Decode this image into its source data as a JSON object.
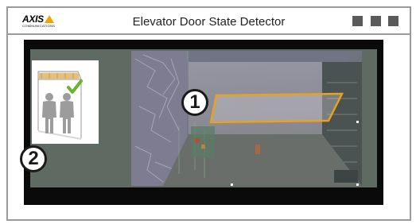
{
  "header": {
    "logo_text": "AXIS",
    "logo_subtext": "COMMUNICATIONS",
    "title": "Elevator Door State Detector",
    "window_buttons": [
      "minimize",
      "maximize",
      "close"
    ]
  },
  "callouts": [
    {
      "label": "1",
      "refers_to": "detection-zone"
    },
    {
      "label": "2",
      "refers_to": "elevator-occupancy-illustration"
    }
  ],
  "colors": {
    "accent": "#f0a400",
    "zone_outline": "#e8a21c",
    "checkmark": "#6bb52c",
    "video_background": "#5f6a63",
    "frame_border": "#9a9a9a"
  }
}
